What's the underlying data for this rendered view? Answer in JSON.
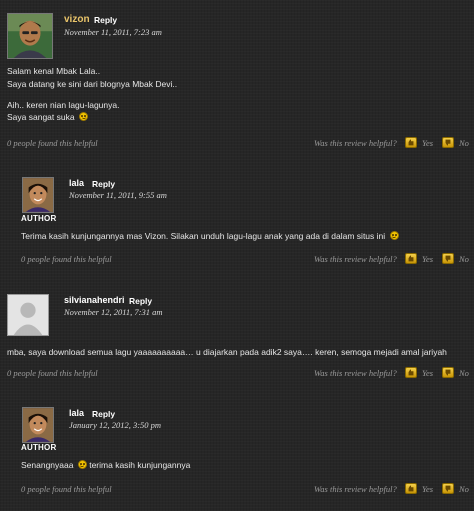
{
  "comments": [
    {
      "author": "vizon",
      "reply_label": "Reply",
      "date": "November 11, 2011, 7:23 am",
      "lines": [
        "Salam kenal Mbak Lala..",
        "Saya datang ke sini dari blognya Mbak Devi..",
        "Aih.. keren nian lagu-lagunya.",
        "Saya sangat suka"
      ],
      "helpful_count_text": "0 people found this helpful",
      "was_helpful_text": "Was this review helpful?",
      "yes_label": "Yes",
      "no_label": "No"
    },
    {
      "author": "lala",
      "author_badge": "AUTHOR",
      "reply_label": "Reply",
      "date": "November 11, 2011, 9:55 am",
      "lines": [
        "Terima kasih kunjungannya mas Vizon. Silakan unduh lagu-lagu anak yang ada di dalam situs ini"
      ],
      "helpful_count_text": "0 people found this helpful",
      "was_helpful_text": "Was this review helpful?",
      "yes_label": "Yes",
      "no_label": "No"
    },
    {
      "author": "silvianahendri",
      "reply_label": "Reply",
      "date": "November 12, 2011, 7:31 am",
      "lines": [
        "mba, saya download semua lagu yaaaaaaaaaa… u diajarkan pada adik2 saya…. keren, semoga mejadi amal jariyah"
      ],
      "helpful_count_text": "0 people found this helpful",
      "was_helpful_text": "Was this review helpful?",
      "yes_label": "Yes",
      "no_label": "No"
    },
    {
      "author": "lala",
      "author_badge": "AUTHOR",
      "reply_label": "Reply",
      "date": "January 12, 2012, 3:50 pm",
      "lines": [
        "Senangnyaaa",
        "terima kasih kunjungannya"
      ],
      "helpful_count_text": "0 people found this helpful",
      "was_helpful_text": "Was this review helpful?",
      "yes_label": "Yes",
      "no_label": "No"
    }
  ],
  "colors": {
    "background": "#262626",
    "author_name_highlight": "#e9c46a",
    "vote_button": "#f2c400"
  }
}
